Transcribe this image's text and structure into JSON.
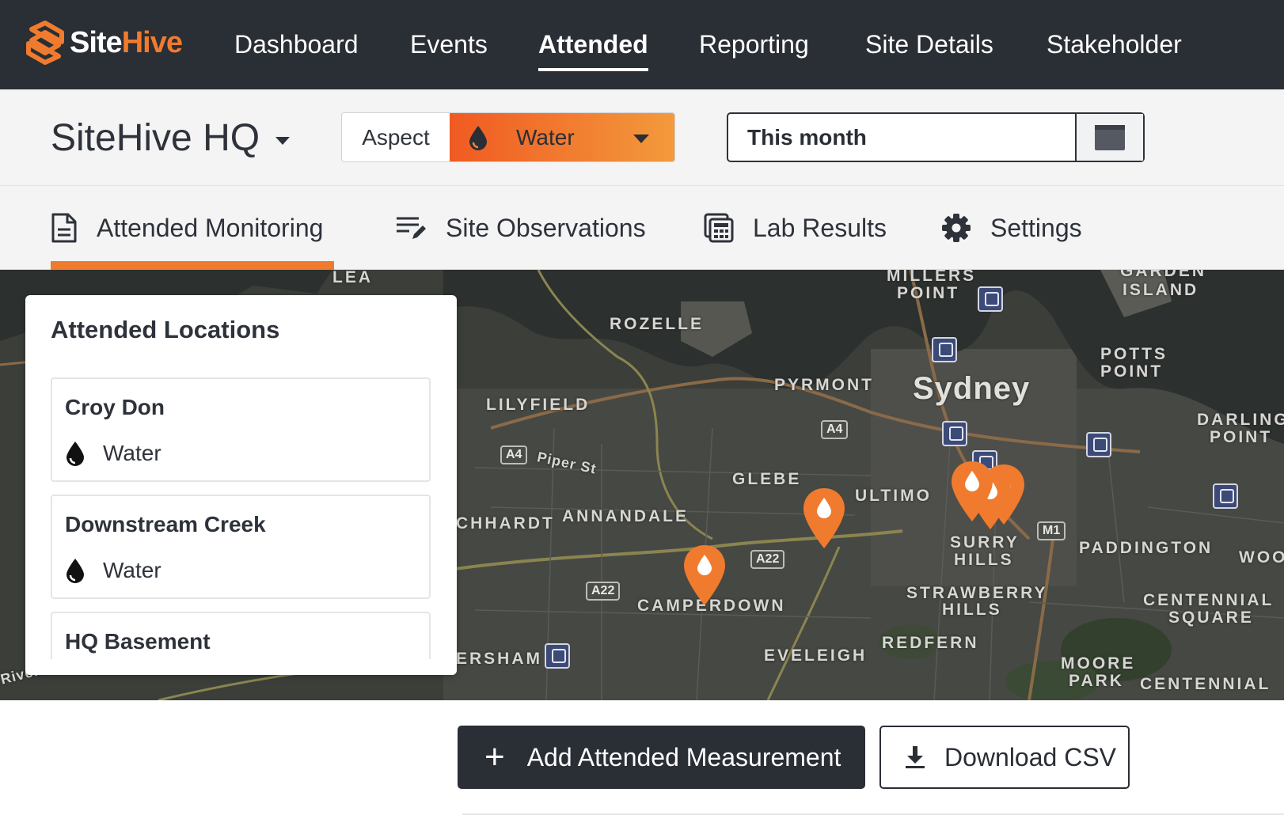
{
  "app": {
    "logo_site": "Site",
    "logo_hive": "Hive",
    "brand_color": "#f07b2e",
    "dark_color": "#2a2e35"
  },
  "nav": {
    "items": [
      {
        "label": "Dashboard"
      },
      {
        "label": "Events"
      },
      {
        "label": "Attended",
        "active": true
      },
      {
        "label": "Reporting"
      },
      {
        "label": "Site Details"
      },
      {
        "label": "Stakeholder"
      }
    ]
  },
  "filters": {
    "site": "SiteHive HQ",
    "aspect_label": "Aspect",
    "aspect_value": "Water",
    "date_range": "This month"
  },
  "tabs": [
    {
      "label": "Attended Monitoring",
      "icon": "document-icon",
      "active": true
    },
    {
      "label": "Site Observations",
      "icon": "edit-list-icon"
    },
    {
      "label": "Lab Results",
      "icon": "calculator-icon"
    },
    {
      "label": "Settings",
      "icon": "gear-icon"
    }
  ],
  "map": {
    "labels": [
      "LEA",
      "ROZELLE",
      "MILLERS",
      "POINT",
      "GARDEN",
      "ISLAND",
      "PYRMONT",
      "Sydney",
      "POTTS",
      "POINT",
      "LILYFIELD",
      "DARLING",
      "POINT",
      "GLEBE",
      "ULTIMO",
      "CHHARDT",
      "ANNANDALE",
      "SURRY",
      "HILLS",
      "PADDINGTON",
      "WOO",
      "CAMPERDOWN",
      "STRAWBERRY",
      "HILLS",
      "CENTENNIAL",
      "SQUARE",
      "REDFERN",
      "ERSHAM",
      "EVELEIGH",
      "MOORE",
      "PARK",
      "CENTENNIAL",
      "Piper St",
      "River Rd"
    ],
    "road_shields": [
      "A4",
      "A4",
      "A22",
      "A22",
      "M1"
    ]
  },
  "locations_panel": {
    "title": "Attended Locations",
    "items": [
      {
        "name": "Croy Don",
        "aspect": "Water"
      },
      {
        "name": "Downstream Creek",
        "aspect": "Water"
      },
      {
        "name": "HQ Basement",
        "aspect": ""
      }
    ]
  },
  "actions": {
    "add_label": "Add Attended Measurement",
    "add_icon": "+",
    "csv_label": "Download CSV"
  }
}
